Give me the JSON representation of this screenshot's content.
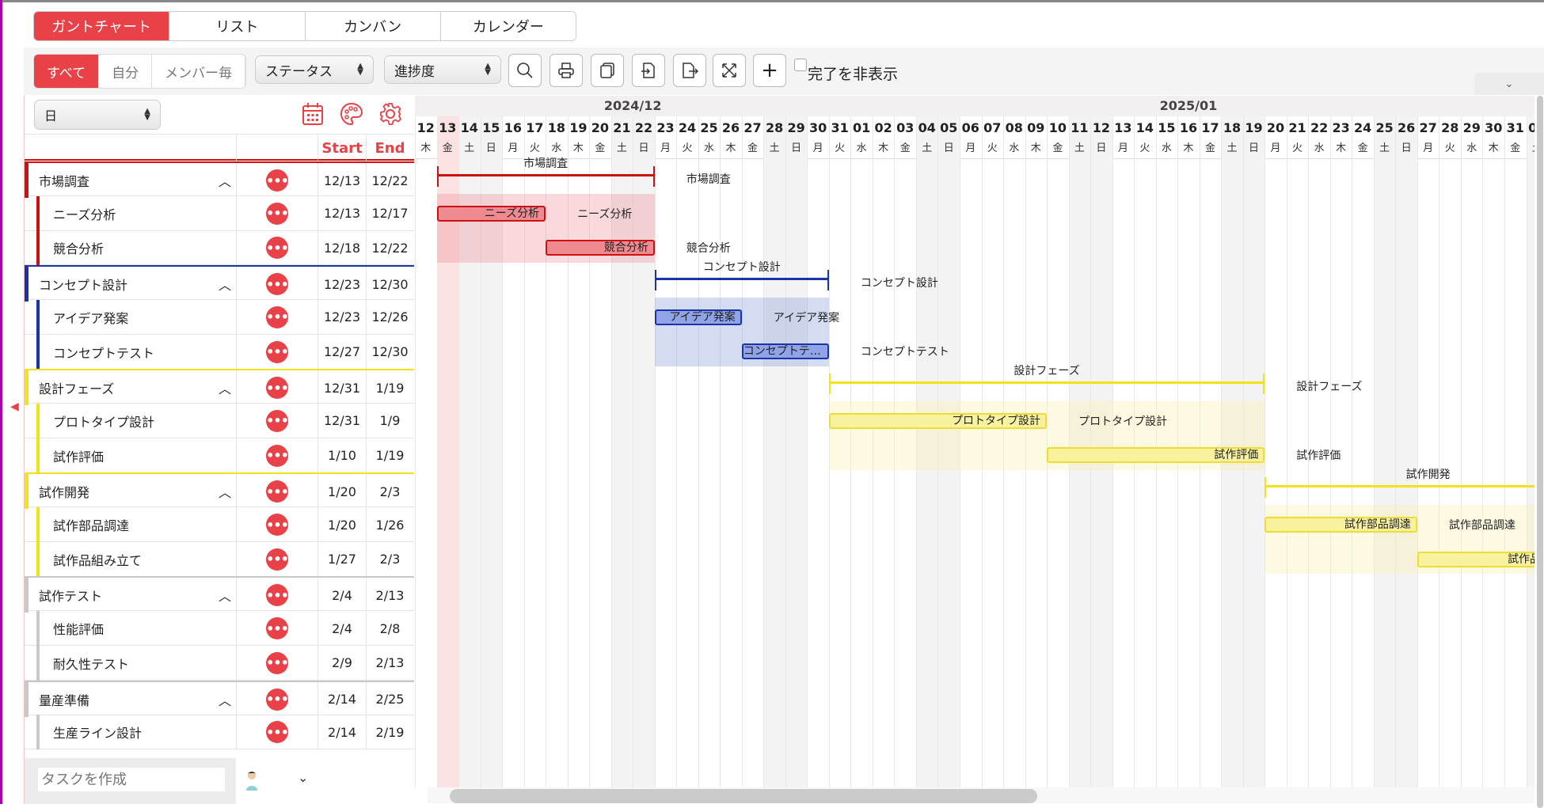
{
  "tabs": [
    {
      "label": "ガントチャート",
      "active": true
    },
    {
      "label": "リスト"
    },
    {
      "label": "カンバン"
    },
    {
      "label": "カレンダー"
    }
  ],
  "filters": [
    {
      "label": "すべて",
      "active": true
    },
    {
      "label": "自分"
    },
    {
      "label": "メンバー毎"
    }
  ],
  "status_select": "ステータス",
  "progress_select": "進捗度",
  "scale_select": "日",
  "hide_completed": "完了を非表示",
  "columns": {
    "start": "Start",
    "end": "End"
  },
  "months": [
    "2024/12",
    "2025/01"
  ],
  "today": "12/13",
  "create_placeholder": "タスクを作成",
  "colors": {
    "accent": "#e84147",
    "red": "#cc1111",
    "blue": "#1a33a8",
    "yellow": "#f2e21c",
    "gray": "#c8c8cc"
  },
  "groups": [
    {
      "name": "市場調査",
      "start": "12/13",
      "end": "12/22",
      "color": "red",
      "tasks": [
        {
          "name": "ニーズ分析",
          "start": "12/13",
          "end": "12/17"
        },
        {
          "name": "競合分析",
          "start": "12/18",
          "end": "12/22"
        }
      ]
    },
    {
      "name": "コンセプト設計",
      "start": "12/23",
      "end": "12/30",
      "color": "blue",
      "tasks": [
        {
          "name": "アイデア発案",
          "start": "12/23",
          "end": "12/26"
        },
        {
          "name": "コンセプトテスト",
          "start": "12/27",
          "end": "12/30"
        }
      ]
    },
    {
      "name": "設計フェーズ",
      "start": "12/31",
      "end": "1/19",
      "color": "yellow",
      "tasks": [
        {
          "name": "プロトタイプ設計",
          "start": "12/31",
          "end": "1/9"
        },
        {
          "name": "試作評価",
          "start": "1/10",
          "end": "1/19"
        }
      ]
    },
    {
      "name": "試作開発",
      "start": "1/20",
      "end": "2/3",
      "color": "yellow",
      "tasks": [
        {
          "name": "試作部品調達",
          "start": "1/20",
          "end": "1/26"
        },
        {
          "name": "試作品組み立て",
          "start": "1/27",
          "end": "2/3"
        }
      ]
    },
    {
      "name": "試作テスト",
      "start": "2/4",
      "end": "2/13",
      "color": "gray",
      "tasks": [
        {
          "name": "性能評価",
          "start": "2/4",
          "end": "2/8"
        },
        {
          "name": "耐久性テスト",
          "start": "2/9",
          "end": "2/13"
        }
      ]
    },
    {
      "name": "量産準備",
      "start": "2/14",
      "end": "2/25",
      "color": "gray",
      "tasks": [
        {
          "name": "生産ライン設計",
          "start": "2/14",
          "end": "2/19"
        }
      ]
    }
  ]
}
